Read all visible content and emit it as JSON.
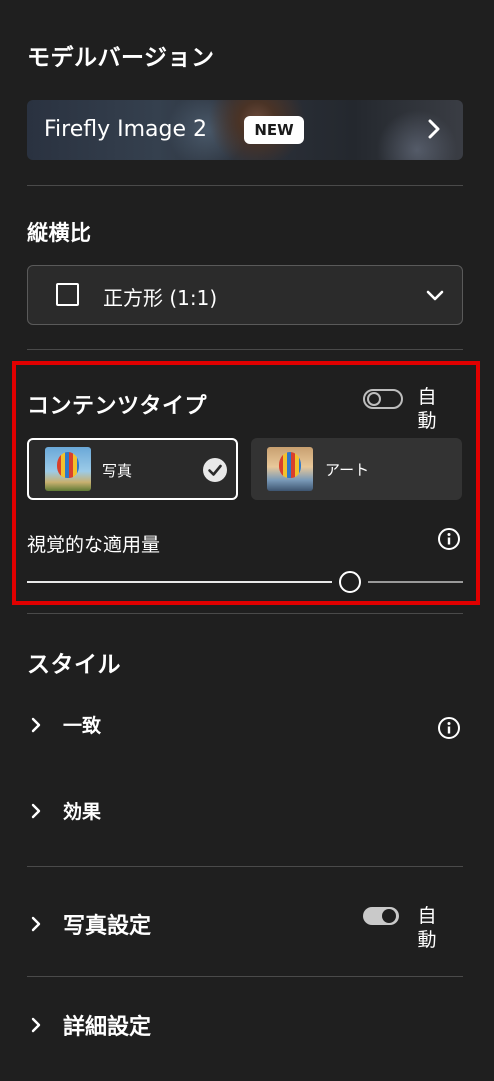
{
  "model_version": {
    "title": "モデルバージョン",
    "model_name": "Firefly Image 2",
    "badge": "NEW"
  },
  "aspect_ratio": {
    "title": "縦横比",
    "selected": "正方形 (1:1)"
  },
  "content_type": {
    "title": "コンテンツタイプ",
    "auto_label": "自動",
    "auto_enabled": false,
    "options": [
      {
        "label": "写真",
        "selected": true
      },
      {
        "label": "アート",
        "selected": false
      }
    ],
    "strength_label": "視覚的な適用量",
    "strength_value": 0.74
  },
  "style": {
    "title": "スタイル",
    "items": [
      {
        "label": "一致"
      },
      {
        "label": "効果"
      }
    ]
  },
  "photo_settings": {
    "label": "写真設定",
    "auto_label": "自動",
    "auto_enabled": true
  },
  "advanced": {
    "label": "詳細設定"
  },
  "colors": {
    "background": "#1f1f1f",
    "highlight": "#e00000",
    "text": "#ffffff"
  }
}
